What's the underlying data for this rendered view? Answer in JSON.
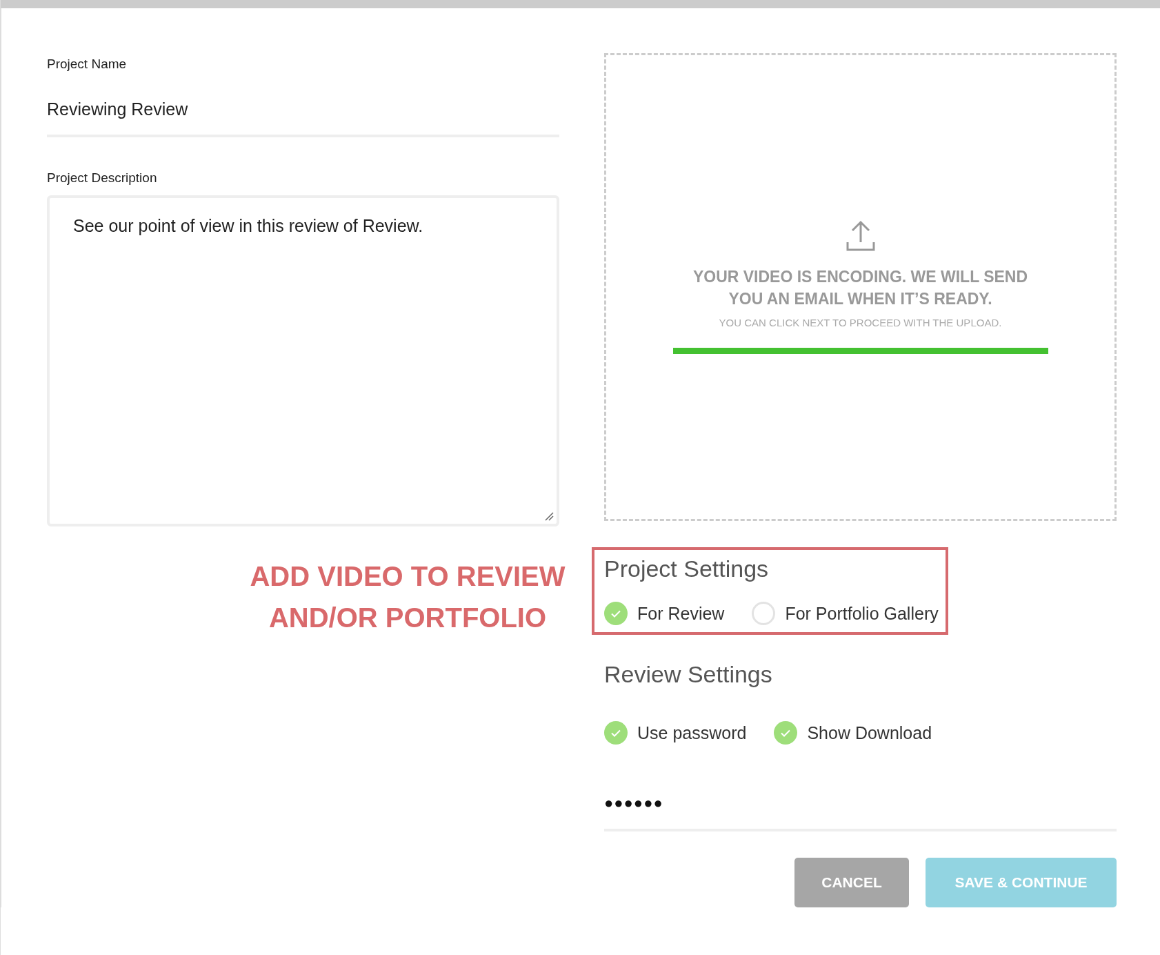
{
  "project_name": {
    "label": "Project Name",
    "value": "Reviewing Review"
  },
  "project_description": {
    "label": "Project Description",
    "value": "See our point of view in this review of Review."
  },
  "upload": {
    "title": "YOUR VIDEO IS ENCODING. WE WILL SEND YOU AN EMAIL WHEN IT’S READY.",
    "subtitle": "YOU CAN CLICK NEXT TO PROCEED WITH THE UPLOAD.",
    "level": 1
  },
  "annotation": "ADD VIDEO TO REVIEW AND/OR PORTFOLIO",
  "project_settings": {
    "title": "Project Settings",
    "options": [
      {
        "label": "For Review",
        "checked": true
      },
      {
        "label": "For Portfolio Gallery",
        "checked": false
      }
    ]
  },
  "review_settings": {
    "title": "Review Settings",
    "options": [
      {
        "label": "Use password",
        "checked": true
      },
      {
        "label": "Show Download",
        "checked": true
      }
    ]
  },
  "password": {
    "value": "●●●●●●"
  },
  "buttons": [
    {
      "label": "CANCEL",
      "kind": "secondary"
    },
    {
      "label": "SAVE & CONTINUE",
      "kind": "primary"
    }
  ]
}
